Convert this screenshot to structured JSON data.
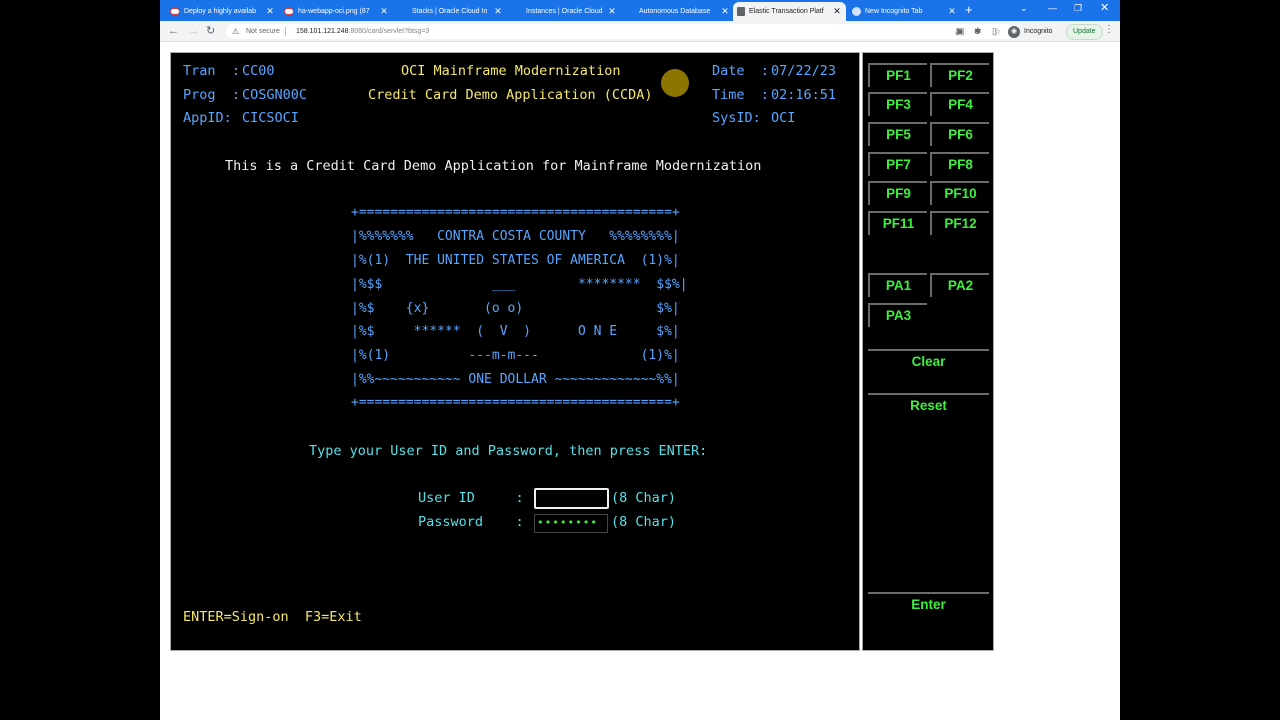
{
  "browser": {
    "tabs": [
      {
        "title": "Deploy a highly availab",
        "icon": "oracle-icon",
        "active": false
      },
      {
        "title": "ha-webapp-oci.png (87",
        "icon": "oracle-icon",
        "active": false
      },
      {
        "title": "Stacks | Oracle Cloud In",
        "icon": "none",
        "active": false
      },
      {
        "title": "Instances | Oracle Cloud",
        "icon": "none",
        "active": false
      },
      {
        "title": "Autonomous Database",
        "icon": "none",
        "active": false
      },
      {
        "title": "Elastic Transaction Platf",
        "icon": "page-icon",
        "active": true
      },
      {
        "title": "New Incognito Tab",
        "icon": "globe-icon",
        "active": false
      }
    ],
    "new_tab": "+",
    "address": {
      "security_label": "Not secure",
      "host": "158.101.121.248",
      "path": ":8080/card/servlet?btsg=3"
    },
    "profile_label": "Incognito",
    "update_label": "Update"
  },
  "terminal": {
    "tran_label": "Tran  :",
    "tran_value": "CC00",
    "prog_label": "Prog  :",
    "prog_value": "COSGN00C",
    "appid_label": "AppID:",
    "appid_value": "CICSOCI",
    "title1": "OCI Mainframe Modernization",
    "title2": "Credit Card Demo Application (CCDA)",
    "date_label": "Date  :",
    "date_value": "07/22/23",
    "time_label": "Time  :",
    "time_value": "02:16:51",
    "sysid_label": "SysID:",
    "sysid_value": "OCI",
    "intro": "This is a Credit Card Demo Application for Mainframe Modernization",
    "art": [
      "+========================================+",
      "|%%%%%%%   CONTRA COSTA COUNTY   %%%%%%%%|",
      "|%(1)  THE UNITED STATES OF AMERICA  (1)%|",
      "|%$$              ___        ********  $$%|",
      "|%$    {x}       (o o)                 $%|",
      "|%$     ******  (  V  )      O N E     $%|",
      "|%(1)          ---m-m---             (1)%|",
      "|%%~~~~~~~~~~~ ONE DOLLAR ~~~~~~~~~~~~~%%|",
      "+========================================+"
    ],
    "prompt": "Type your User ID and Password, then press ENTER:",
    "userid_label": "User ID     :",
    "userid_value": "",
    "userid_hint": "(8 Char)",
    "password_label": "Password    :",
    "password_value": "••••••••",
    "password_hint": "(8 Char)",
    "footer": "ENTER=Sign-on  F3=Exit"
  },
  "keypad": {
    "pf": [
      "PF1",
      "PF2",
      "PF3",
      "PF4",
      "PF5",
      "PF6",
      "PF7",
      "PF8",
      "PF9",
      "PF10",
      "PF11",
      "PF12"
    ],
    "pa": [
      "PA1",
      "PA2",
      "PA3"
    ],
    "clear": "Clear",
    "reset": "Reset",
    "enter": "Enter"
  }
}
